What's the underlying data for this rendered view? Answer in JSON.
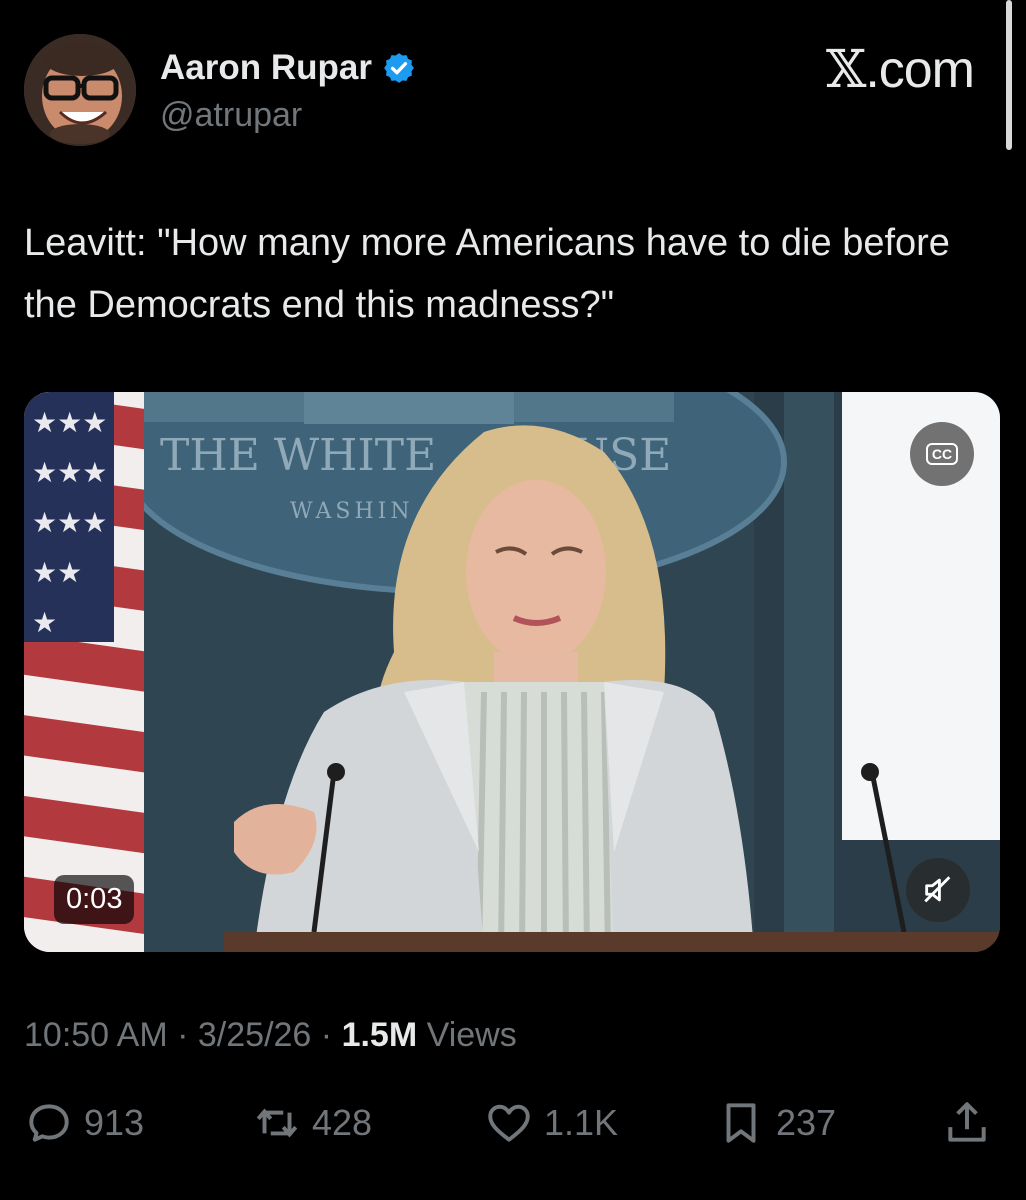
{
  "author": {
    "display_name": "Aaron Rupar",
    "handle": "@atrupar",
    "verified": true
  },
  "brand": {
    "x_glyph": "𝕏",
    "suffix": ".com"
  },
  "tweet": {
    "text": "Leavitt: \"How many more Americans have to die before the Democrats end this madness?\""
  },
  "media": {
    "duration": "0:03",
    "cc_label": "CC",
    "seal_text_line1": "THE WHITE",
    "seal_text_line1b": "USE",
    "seal_text_line2": "WASHIN"
  },
  "meta": {
    "time": "10:50 AM",
    "separator": "·",
    "date": "3/25/26",
    "views_count": "1.5M",
    "views_label": "Views"
  },
  "actions": {
    "replies": "913",
    "reposts": "428",
    "likes": "1.1K",
    "bookmarks": "237"
  },
  "colors": {
    "background": "#000000",
    "text_primary": "#e7e9ea",
    "text_secondary": "#71767b",
    "verified_blue": "#1d9bf0"
  }
}
